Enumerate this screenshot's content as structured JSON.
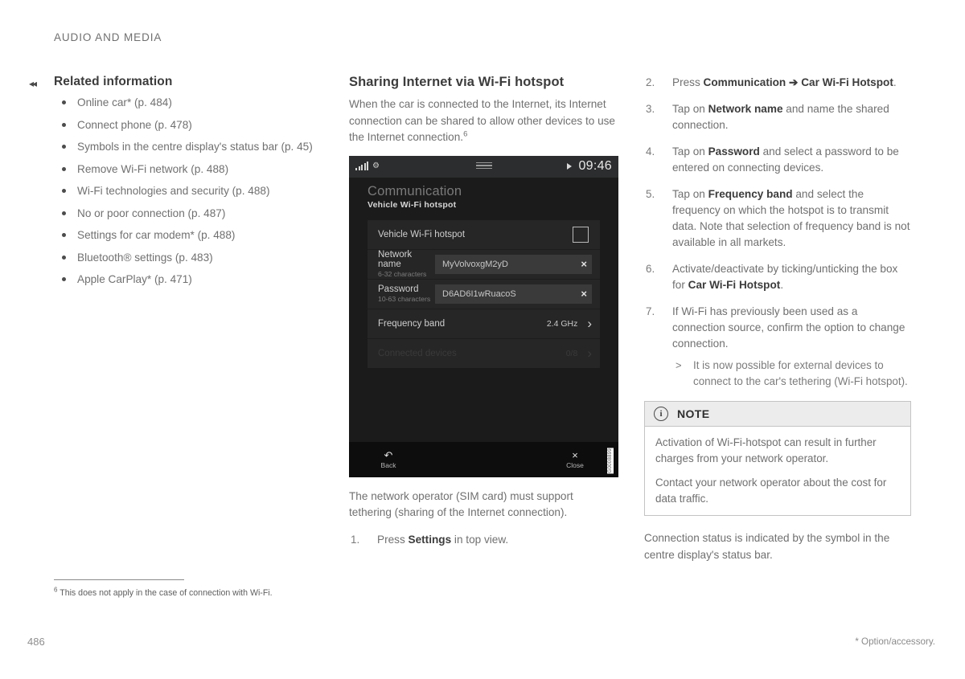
{
  "running_head": "AUDIO AND MEDIA",
  "left_column": {
    "backref_icon": "double-left-arrow",
    "title": "Related information",
    "items": [
      "Online car* (p. 484)",
      "Connect phone (p. 478)",
      "Symbols in the centre display's status bar (p. 45)",
      "Remove Wi-Fi network (p. 488)",
      "Wi-Fi technologies and security (p. 488)",
      "No or poor connection (p. 487)",
      "Settings for car modem* (p. 488)",
      "Bluetooth® settings (p. 483)",
      "Apple CarPlay* (p. 471)"
    ]
  },
  "middle_column": {
    "title": "Sharing Internet via Wi-Fi hotspot",
    "intro_part1": "When the car is connected to the Internet, its Internet connection can be shared to allow other devices to use the Internet connection.",
    "intro_footnote_marker": "6",
    "display": {
      "status_bar": {
        "signal_icon": "signal-bars-icon",
        "bluetooth_icon": "bluetooth-icon",
        "handle_icon": "drag-handle-icon",
        "play_icon": "play-triangle-icon",
        "clock": "09:46"
      },
      "title": "Communication",
      "subtitle": "Vehicle Wi-Fi hotspot",
      "rows": [
        {
          "label": "Vehicle Wi-Fi hotspot",
          "control": "checkbox",
          "checked": false
        },
        {
          "label": "Network name",
          "sublabel": "6-32 characters",
          "control": "textfield",
          "value": "MyVolvoxgM2yD",
          "clear_icon": "×"
        },
        {
          "label": "Password",
          "sublabel": "10-63 characters",
          "control": "textfield",
          "value": "D6AD6I1wRuacoS",
          "clear_icon": "×"
        },
        {
          "label": "Frequency band",
          "control": "chevron",
          "value": "2.4 GHz",
          "chevron_icon": "›"
        },
        {
          "label": "Connected devices",
          "control": "chevron",
          "value": "0/8",
          "chevron_icon": "›",
          "disabled": true
        }
      ],
      "bottom_bar": {
        "back_icon": "back-arrow-icon",
        "back_label": "Back",
        "close_icon": "×",
        "close_label": "Close"
      },
      "image_code": "G0008899"
    },
    "caption": "The network operator (SIM card) must support tethering (sharing of the Internet connection).",
    "step1": {
      "num": "1.",
      "pre": "Press ",
      "bold": "Settings",
      "post": " in top view."
    }
  },
  "right_column": {
    "steps": [
      {
        "num": "2.",
        "segments": [
          {
            "t": "Press ",
            "b": false
          },
          {
            "t": "Communication",
            "b": true
          },
          {
            "t": " ➔ ",
            "b": true
          },
          {
            "t": "Car Wi-Fi Hotspot",
            "b": true
          },
          {
            "t": ".",
            "b": false
          }
        ]
      },
      {
        "num": "3.",
        "segments": [
          {
            "t": "Tap on ",
            "b": false
          },
          {
            "t": "Network name",
            "b": true
          },
          {
            "t": " and name the shared connection.",
            "b": false
          }
        ]
      },
      {
        "num": "4.",
        "segments": [
          {
            "t": "Tap on ",
            "b": false
          },
          {
            "t": "Password",
            "b": true
          },
          {
            "t": " and select a password to be entered on connecting devices.",
            "b": false
          }
        ]
      },
      {
        "num": "5.",
        "segments": [
          {
            "t": "Tap on ",
            "b": false
          },
          {
            "t": "Frequency band",
            "b": true
          },
          {
            "t": " and select the frequency on which the hotspot is to transmit data. Note that selection of frequency band is not available in all markets.",
            "b": false
          }
        ]
      },
      {
        "num": "6.",
        "segments": [
          {
            "t": "Activate/deactivate by ticking/unticking the box for ",
            "b": false
          },
          {
            "t": "Car Wi-Fi Hotspot",
            "b": true
          },
          {
            "t": ".",
            "b": false
          }
        ]
      },
      {
        "num": "7.",
        "segments": [
          {
            "t": "If Wi-Fi has previously been used as a connection source, confirm the option to change connection.",
            "b": false
          }
        ],
        "subresult": "It is now possible for external devices to connect to the car's tethering (Wi-Fi hotspot)."
      }
    ],
    "note": {
      "icon": "info-icon",
      "title": "NOTE",
      "paragraphs": [
        "Activation of Wi-Fi-hotspot can result in further charges from your network operator.",
        "Contact your network operator about the cost for data traffic."
      ]
    },
    "closing": "Connection status is indicated by the symbol in the centre display's status bar."
  },
  "footer": {
    "footnote_marker": "6",
    "footnote": "This does not apply in the case of connection with Wi-Fi.",
    "page_number": "486",
    "option_note": "* Option/accessory."
  }
}
